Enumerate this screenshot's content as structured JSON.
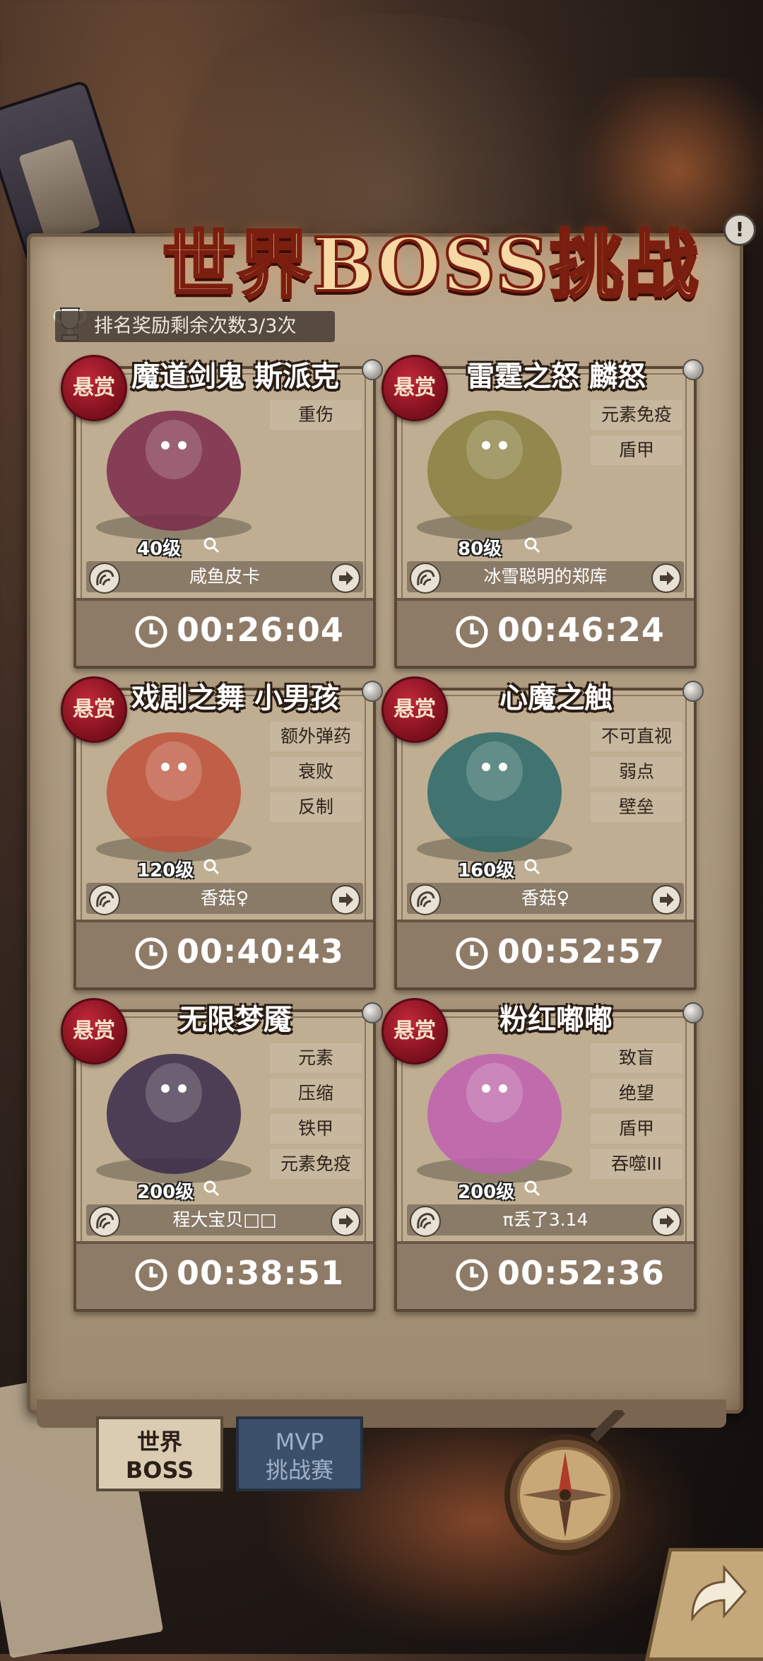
{
  "header": {
    "title": "世界BOSS挑战",
    "info_icon": "info-icon",
    "rank_text": "排名奖励剩余次数3/3次"
  },
  "bounty_label": "悬赏",
  "bosses": [
    {
      "name": "魔道剑鬼 斯派克",
      "tags": [
        "重伤"
      ],
      "level": "40级",
      "player": "咸鱼皮卡",
      "timer": "00:26:04",
      "accent": "#7a2a4a"
    },
    {
      "name": "雷霆之怒 麟怒",
      "tags": [
        "元素免疫",
        "盾甲"
      ],
      "level": "80级",
      "player": "冰雪聪明的郑库",
      "timer": "00:46:24",
      "accent": "#8a8040"
    },
    {
      "name": "戏剧之舞 小男孩",
      "tags": [
        "额外弹药",
        "衰败",
        "反制"
      ],
      "level": "120级",
      "player": "香菇♀",
      "timer": "00:40:43",
      "accent": "#c0503a"
    },
    {
      "name": "心魔之触",
      "tags": [
        "不可直视",
        "弱点",
        "壁垒"
      ],
      "level": "160级",
      "player": "香菇♀",
      "timer": "00:52:57",
      "accent": "#2a6a6a"
    },
    {
      "name": "无限梦魇",
      "tags": [
        "元素",
        "压缩",
        "铁甲",
        "元素免疫"
      ],
      "level": "200级",
      "player": "程大宝贝□□",
      "timer": "00:38:51",
      "accent": "#3a2a4a"
    },
    {
      "name": "粉红嘟嘟",
      "tags": [
        "致盲",
        "绝望",
        "盾甲",
        "吞噬III"
      ],
      "level": "200级",
      "player": "π丢了3.14",
      "timer": "00:52:36",
      "accent": "#c060b0"
    }
  ],
  "tabs": {
    "world_line1": "世界",
    "world_line2": "BOSS",
    "mvp_line1": "MVP",
    "mvp_line2": "挑战赛"
  }
}
